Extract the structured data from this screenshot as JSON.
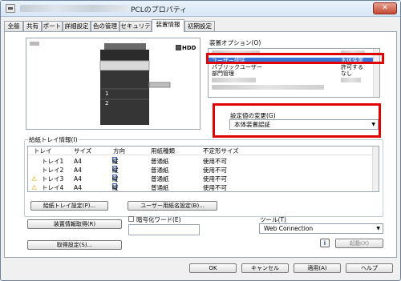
{
  "window": {
    "title": "PCLのプロパティ",
    "close_glyph": "✕"
  },
  "tabs": [
    {
      "label": "全般"
    },
    {
      "label": "共有"
    },
    {
      "label": "ポート"
    },
    {
      "label": "詳細設定"
    },
    {
      "label": "色の管理"
    },
    {
      "label": "セキュリティ"
    },
    {
      "label": "装置情報",
      "active": true
    },
    {
      "label": "初期設定"
    }
  ],
  "preview": {
    "hdd_label": "HDD",
    "tray_numbers": [
      "1",
      "2"
    ]
  },
  "device_options": {
    "label": "装置オプション(O)",
    "items": [
      {
        "name": "ユーザー認証",
        "value": "本体装置",
        "selected": true
      },
      {
        "name": "パブリックユーザー",
        "value": "許可する"
      },
      {
        "name": "部門管理",
        "value": "なし"
      }
    ]
  },
  "setting_change": {
    "label": "設定値の変更(G)",
    "value": "本体装置認証"
  },
  "tray_info": {
    "label": "給紙トレイ情報(I)",
    "columns": [
      "トレイ",
      "サイズ",
      "方向",
      "用紙種類",
      "不定形サイズ"
    ],
    "rows": [
      {
        "tray": "トレイ1",
        "size": "A4",
        "direction": "縦",
        "paper": "普通紙",
        "custom": "使用不可",
        "warning": false
      },
      {
        "tray": "トレイ2",
        "size": "A4",
        "direction": "縦",
        "paper": "普通紙",
        "custom": "使用不可",
        "warning": false
      },
      {
        "tray": "トレイ3",
        "size": "A4",
        "direction": "縦",
        "paper": "普通紙",
        "custom": "使用不可",
        "warning": true
      },
      {
        "tray": "トレイ4",
        "size": "A4",
        "direction": "縦",
        "paper": "普通紙",
        "custom": "使用不可",
        "warning": true
      }
    ]
  },
  "buttons": {
    "tray_settings": "給紙トレイ設定(P)...",
    "user_paper": "ユーザー用紙名設定(B)...",
    "get_device_info": "装置情報取得(R)",
    "get_settings": "取得設定(S)...",
    "launch": "起動(X)",
    "ok": "OK",
    "cancel": "キャンセル",
    "apply": "適用(A)",
    "help": "ヘルプ"
  },
  "encryption": {
    "label": "暗号化ワード(E)",
    "checked": false,
    "value": ""
  },
  "tool": {
    "label": "ツール(T)",
    "value": "Web Connection"
  },
  "colors": {
    "highlight_box": "#e00000",
    "selection": "#3874d8"
  }
}
